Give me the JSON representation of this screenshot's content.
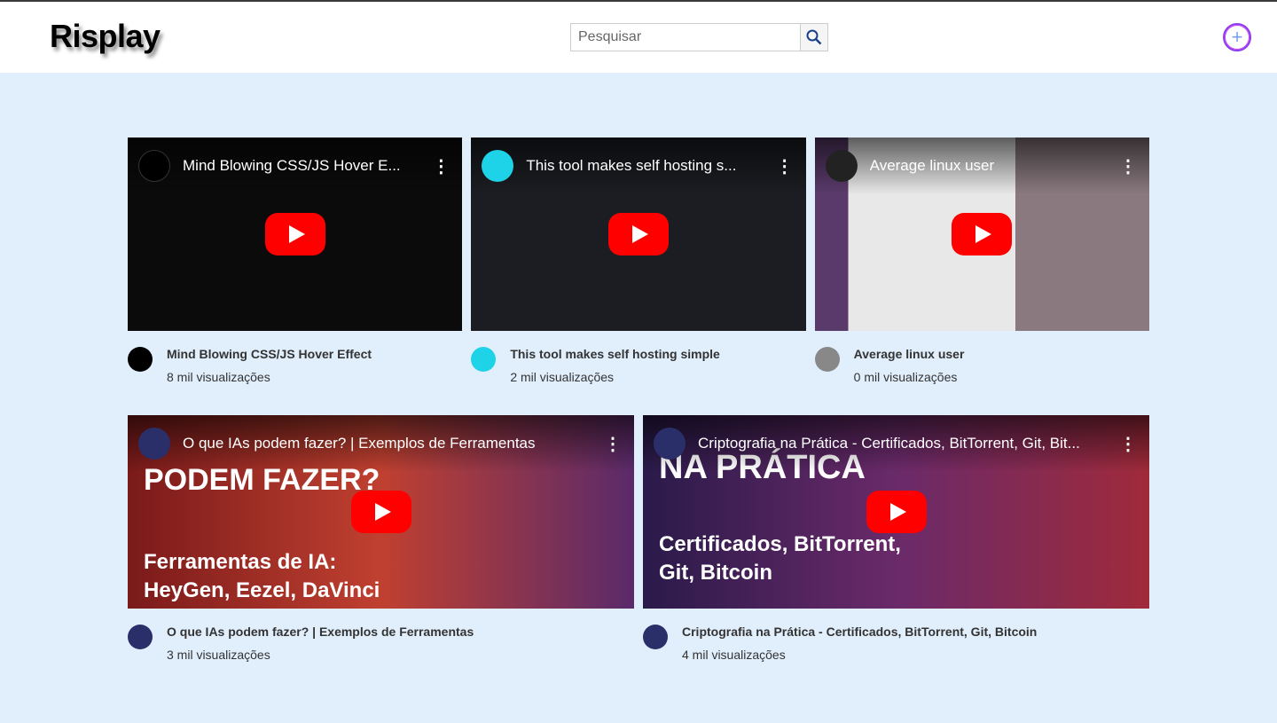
{
  "header": {
    "logo": "Risplay",
    "search_placeholder": "Pesquisar",
    "add_label": "+"
  },
  "videos": [
    {
      "title": "Mind Blowing CSS/JS Hover Effect",
      "player_title": "Mind Blowing CSS/JS Hover E...",
      "views": "8 mil visualizações",
      "bg": "#0b0b0b",
      "av": "#000"
    },
    {
      "title": "This tool makes self hosting simple",
      "player_title": "This tool makes self hosting s...",
      "views": "2 mil visualizações",
      "bg": "#1b1d22",
      "av": "#1ed3e8"
    },
    {
      "title": "Average linux user",
      "player_title": "Average linux user",
      "views": "0 mil visualizações",
      "bg": "#6b6470",
      "av": "#888"
    },
    {
      "title": "O que IAs podem fazer? | Exemplos de Ferramentas",
      "player_title": "O que IAs podem fazer? | Exemplos de Ferramentas",
      "views": "3 mil visualizações",
      "bg": "#8a2a2a",
      "av": "#2a2f6a"
    },
    {
      "title": "Criptografia na Prática - Certificados, BitTorrent, Git, Bitcoin",
      "player_title": "Criptografia na Prática - Certificados, BitTorrent, Git, Bit...",
      "views": "4 mil visualizações",
      "bg": "#3a1f5a",
      "av": "#2a2f6a"
    }
  ],
  "overlay_text": {
    "v4_line1": "PODEM FAZER?",
    "v4_line2": "Ferramentas de IA:",
    "v4_line3": "HeyGen, Eezel, DaVinci",
    "v5_line1": "NA PRÁTICA",
    "v5_line2": "Certificados, BitTorrent,",
    "v5_line3": "Git, Bitcoin"
  }
}
